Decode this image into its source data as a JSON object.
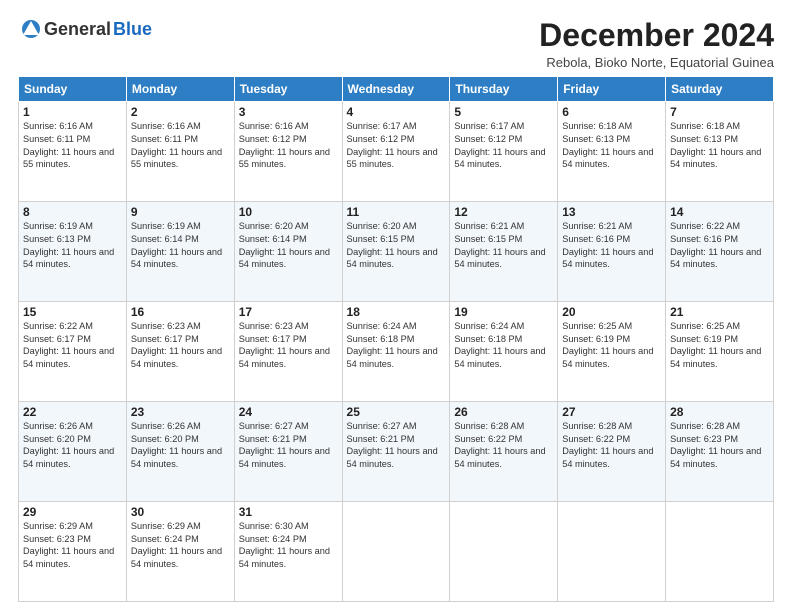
{
  "logo": {
    "general": "General",
    "blue": "Blue"
  },
  "title": "December 2024",
  "location": "Rebola, Bioko Norte, Equatorial Guinea",
  "days_of_week": [
    "Sunday",
    "Monday",
    "Tuesday",
    "Wednesday",
    "Thursday",
    "Friday",
    "Saturday"
  ],
  "weeks": [
    [
      {
        "day": "1",
        "sunrise": "6:16 AM",
        "sunset": "6:11 PM",
        "daylight": "11 hours and 55 minutes."
      },
      {
        "day": "2",
        "sunrise": "6:16 AM",
        "sunset": "6:11 PM",
        "daylight": "11 hours and 55 minutes."
      },
      {
        "day": "3",
        "sunrise": "6:16 AM",
        "sunset": "6:12 PM",
        "daylight": "11 hours and 55 minutes."
      },
      {
        "day": "4",
        "sunrise": "6:17 AM",
        "sunset": "6:12 PM",
        "daylight": "11 hours and 55 minutes."
      },
      {
        "day": "5",
        "sunrise": "6:17 AM",
        "sunset": "6:12 PM",
        "daylight": "11 hours and 54 minutes."
      },
      {
        "day": "6",
        "sunrise": "6:18 AM",
        "sunset": "6:13 PM",
        "daylight": "11 hours and 54 minutes."
      },
      {
        "day": "7",
        "sunrise": "6:18 AM",
        "sunset": "6:13 PM",
        "daylight": "11 hours and 54 minutes."
      }
    ],
    [
      {
        "day": "8",
        "sunrise": "6:19 AM",
        "sunset": "6:13 PM",
        "daylight": "11 hours and 54 minutes."
      },
      {
        "day": "9",
        "sunrise": "6:19 AM",
        "sunset": "6:14 PM",
        "daylight": "11 hours and 54 minutes."
      },
      {
        "day": "10",
        "sunrise": "6:20 AM",
        "sunset": "6:14 PM",
        "daylight": "11 hours and 54 minutes."
      },
      {
        "day": "11",
        "sunrise": "6:20 AM",
        "sunset": "6:15 PM",
        "daylight": "11 hours and 54 minutes."
      },
      {
        "day": "12",
        "sunrise": "6:21 AM",
        "sunset": "6:15 PM",
        "daylight": "11 hours and 54 minutes."
      },
      {
        "day": "13",
        "sunrise": "6:21 AM",
        "sunset": "6:16 PM",
        "daylight": "11 hours and 54 minutes."
      },
      {
        "day": "14",
        "sunrise": "6:22 AM",
        "sunset": "6:16 PM",
        "daylight": "11 hours and 54 minutes."
      }
    ],
    [
      {
        "day": "15",
        "sunrise": "6:22 AM",
        "sunset": "6:17 PM",
        "daylight": "11 hours and 54 minutes."
      },
      {
        "day": "16",
        "sunrise": "6:23 AM",
        "sunset": "6:17 PM",
        "daylight": "11 hours and 54 minutes."
      },
      {
        "day": "17",
        "sunrise": "6:23 AM",
        "sunset": "6:17 PM",
        "daylight": "11 hours and 54 minutes."
      },
      {
        "day": "18",
        "sunrise": "6:24 AM",
        "sunset": "6:18 PM",
        "daylight": "11 hours and 54 minutes."
      },
      {
        "day": "19",
        "sunrise": "6:24 AM",
        "sunset": "6:18 PM",
        "daylight": "11 hours and 54 minutes."
      },
      {
        "day": "20",
        "sunrise": "6:25 AM",
        "sunset": "6:19 PM",
        "daylight": "11 hours and 54 minutes."
      },
      {
        "day": "21",
        "sunrise": "6:25 AM",
        "sunset": "6:19 PM",
        "daylight": "11 hours and 54 minutes."
      }
    ],
    [
      {
        "day": "22",
        "sunrise": "6:26 AM",
        "sunset": "6:20 PM",
        "daylight": "11 hours and 54 minutes."
      },
      {
        "day": "23",
        "sunrise": "6:26 AM",
        "sunset": "6:20 PM",
        "daylight": "11 hours and 54 minutes."
      },
      {
        "day": "24",
        "sunrise": "6:27 AM",
        "sunset": "6:21 PM",
        "daylight": "11 hours and 54 minutes."
      },
      {
        "day": "25",
        "sunrise": "6:27 AM",
        "sunset": "6:21 PM",
        "daylight": "11 hours and 54 minutes."
      },
      {
        "day": "26",
        "sunrise": "6:28 AM",
        "sunset": "6:22 PM",
        "daylight": "11 hours and 54 minutes."
      },
      {
        "day": "27",
        "sunrise": "6:28 AM",
        "sunset": "6:22 PM",
        "daylight": "11 hours and 54 minutes."
      },
      {
        "day": "28",
        "sunrise": "6:28 AM",
        "sunset": "6:23 PM",
        "daylight": "11 hours and 54 minutes."
      }
    ],
    [
      {
        "day": "29",
        "sunrise": "6:29 AM",
        "sunset": "6:23 PM",
        "daylight": "11 hours and 54 minutes."
      },
      {
        "day": "30",
        "sunrise": "6:29 AM",
        "sunset": "6:24 PM",
        "daylight": "11 hours and 54 minutes."
      },
      {
        "day": "31",
        "sunrise": "6:30 AM",
        "sunset": "6:24 PM",
        "daylight": "11 hours and 54 minutes."
      },
      null,
      null,
      null,
      null
    ]
  ]
}
